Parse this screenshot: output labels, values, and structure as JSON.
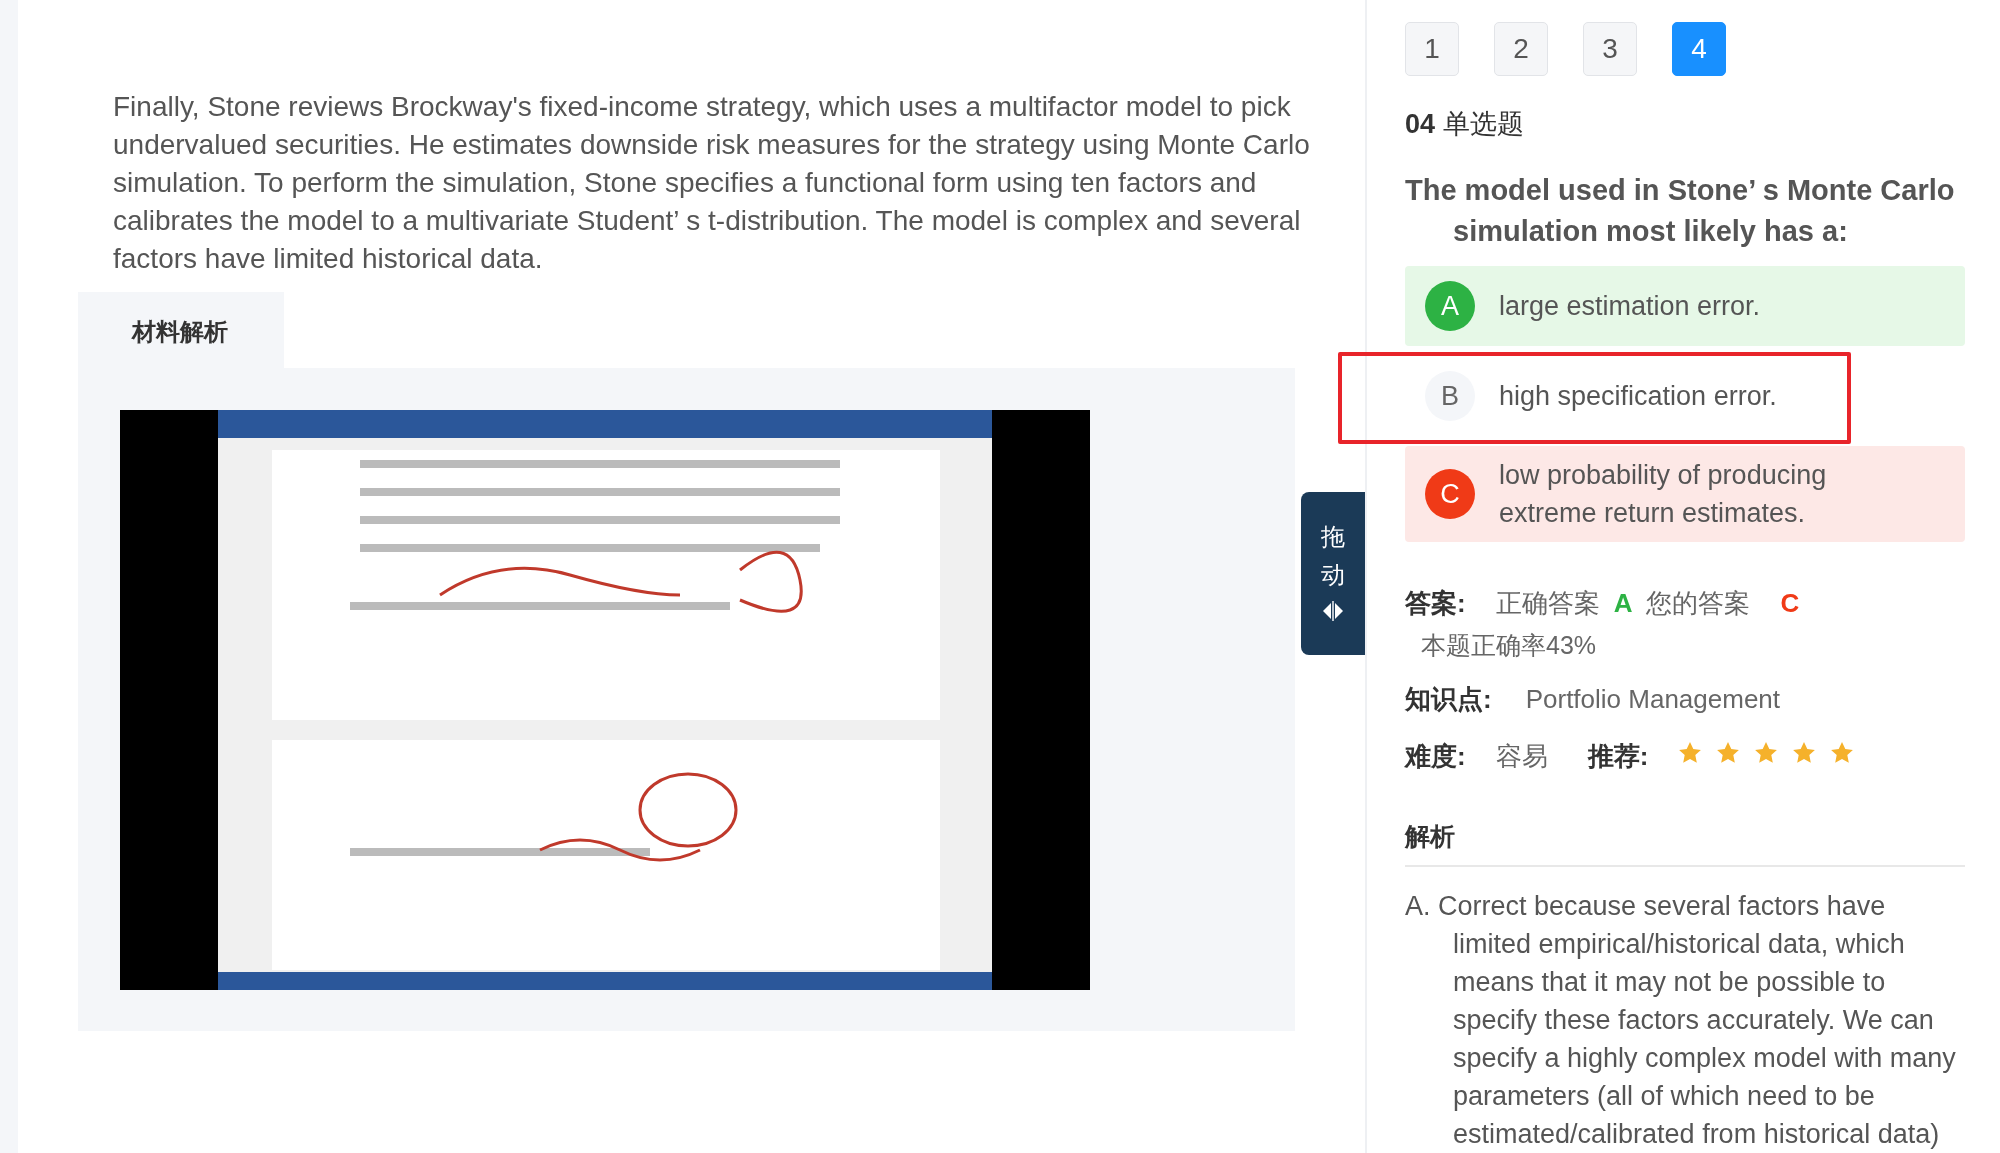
{
  "passage": "Finally, Stone reviews Brockway's fixed-income strategy, which uses a multifactor model to pick undervalued securities. He estimates downside risk measures for the strategy using Monte Carlo simulation. To perform the simulation, Stone specifies a functional form using ten factors and calibrates the model to a multivariate Student’ s t-distribution. The model is complex and several factors have limited historical data.",
  "material_tab": {
    "label": "材料解析"
  },
  "drag_handle": {
    "label": "拖动"
  },
  "question_nav": [
    {
      "label": "1",
      "selected": false
    },
    {
      "label": "2",
      "selected": false
    },
    {
      "label": "3",
      "selected": false
    },
    {
      "label": "4",
      "selected": true
    }
  ],
  "question": {
    "number": "04",
    "type": "单选题",
    "text": "The model used in Stone’ s Monte Carlo simulation most likely has a:"
  },
  "options": [
    {
      "letter": "A",
      "text": "large estimation error.",
      "kind": "correct",
      "boxed": false
    },
    {
      "letter": "B",
      "text": "high specification error.",
      "kind": "plain",
      "boxed": true
    },
    {
      "letter": "C",
      "text": "low probability of producing extreme return estimates.",
      "kind": "wrong",
      "boxed": false
    }
  ],
  "answer": {
    "label": "答案:",
    "correct_label": "正确答案",
    "correct": "A",
    "yours_label": "您的答案",
    "yours": "C",
    "rate": "本题正确率43%"
  },
  "knowledge": {
    "label": "知识点:",
    "value": "Portfolio Management"
  },
  "difficulty": {
    "label": "难度:",
    "value": "容易",
    "recommend_label": "推荐:",
    "stars": 5
  },
  "analysis": {
    "title": "解析",
    "text": "A. Correct because several factors have limited empirical/historical data, which means that it may not be possible to specify these factors accurately. We can specify a highly complex model with many parameters (all of which need to be estimated/calibrated from historical data)"
  }
}
